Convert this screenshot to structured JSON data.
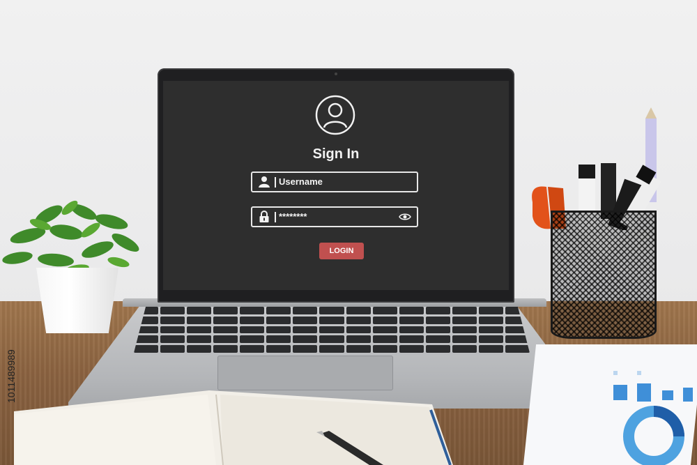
{
  "screen": {
    "title": "Sign In",
    "username_field": {
      "value": "Username"
    },
    "password_field": {
      "value": "********"
    },
    "login_button": {
      "label": "LOGIN"
    }
  },
  "stock_id": "1011489989",
  "colors": {
    "screen_bg": "#2e2e2e",
    "login_button": "#c0504f",
    "field_border": "#e8e8e8"
  },
  "icons": [
    "user-avatar-icon",
    "user-icon",
    "lock-icon",
    "eye-icon"
  ]
}
